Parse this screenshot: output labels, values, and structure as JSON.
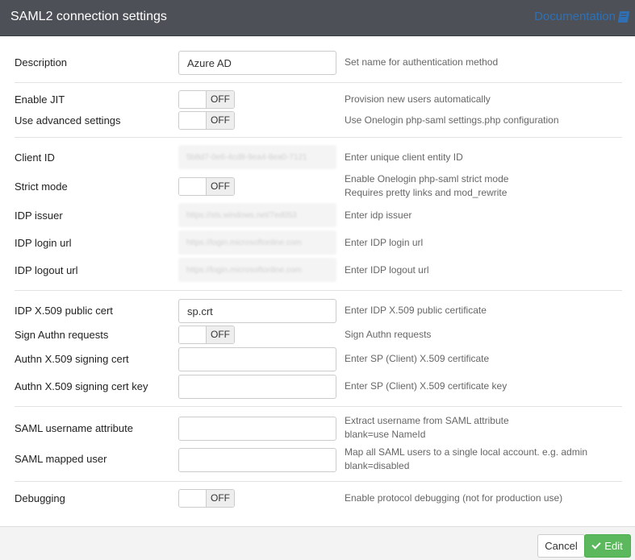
{
  "header": {
    "title": "SAML2 connection settings",
    "doc_label": "Documentation",
    "doc_icon": "book-icon"
  },
  "fields": {
    "description": {
      "label": "Description",
      "value": "Azure AD",
      "help": "Set name for authentication method"
    },
    "enable_jit": {
      "label": "Enable JIT",
      "state": "OFF",
      "help": "Provision new users automatically"
    },
    "advanced": {
      "label": "Use advanced settings",
      "state": "OFF",
      "help": "Use Onelogin php-saml settings.php configuration"
    },
    "client_id": {
      "label": "Client ID",
      "value": "5b8d7-0e6-4cd8-9ea4-8ea0-7121",
      "help": "Enter unique client entity ID"
    },
    "strict_mode": {
      "label": "Strict mode",
      "state": "OFF",
      "help_line1": "Enable Onelogin php-saml strict mode",
      "help_line2": "Requires pretty links and mod_rewrite"
    },
    "idp_issuer": {
      "label": "IDP issuer",
      "value": "https://sts.windows.net/7ed053",
      "help": "Enter idp issuer"
    },
    "idp_login": {
      "label": "IDP login url",
      "value": "https://login.microsoftonline.com",
      "help": "Enter IDP login url"
    },
    "idp_logout": {
      "label": "IDP logout url",
      "value": "https://login.microsoftonline.com",
      "help": "Enter IDP logout url"
    },
    "idp_cert": {
      "label": "IDP X.509 public cert",
      "value": "sp.crt",
      "help": "Enter IDP X.509 public certificate"
    },
    "sign_authn": {
      "label": "Sign Authn requests",
      "state": "OFF",
      "help": "Sign Authn requests"
    },
    "authn_cert": {
      "label": "Authn X.509 signing cert",
      "value": "",
      "help": "Enter SP (Client) X.509 certificate"
    },
    "authn_cert_key": {
      "label": "Authn X.509 signing cert key",
      "value": "",
      "help": "Enter SP (Client) X.509 certificate key"
    },
    "username_attr": {
      "label": "SAML username attribute",
      "value": "",
      "help_line1": "Extract username from SAML attribute",
      "help_line2": "blank=use NameId"
    },
    "mapped_user": {
      "label": "SAML mapped user",
      "value": "",
      "help_line1": "Map all SAML users to a single local account. e.g. admin",
      "help_line2": "blank=disabled"
    },
    "debugging": {
      "label": "Debugging",
      "state": "OFF",
      "help": "Enable protocol debugging (not for production use)"
    }
  },
  "footer": {
    "cancel_label": "Cancel",
    "edit_label": "Edit"
  },
  "colors": {
    "header_bg": "#4d5157",
    "link": "#2f6fb3",
    "edit_button": "#5cb85c"
  }
}
